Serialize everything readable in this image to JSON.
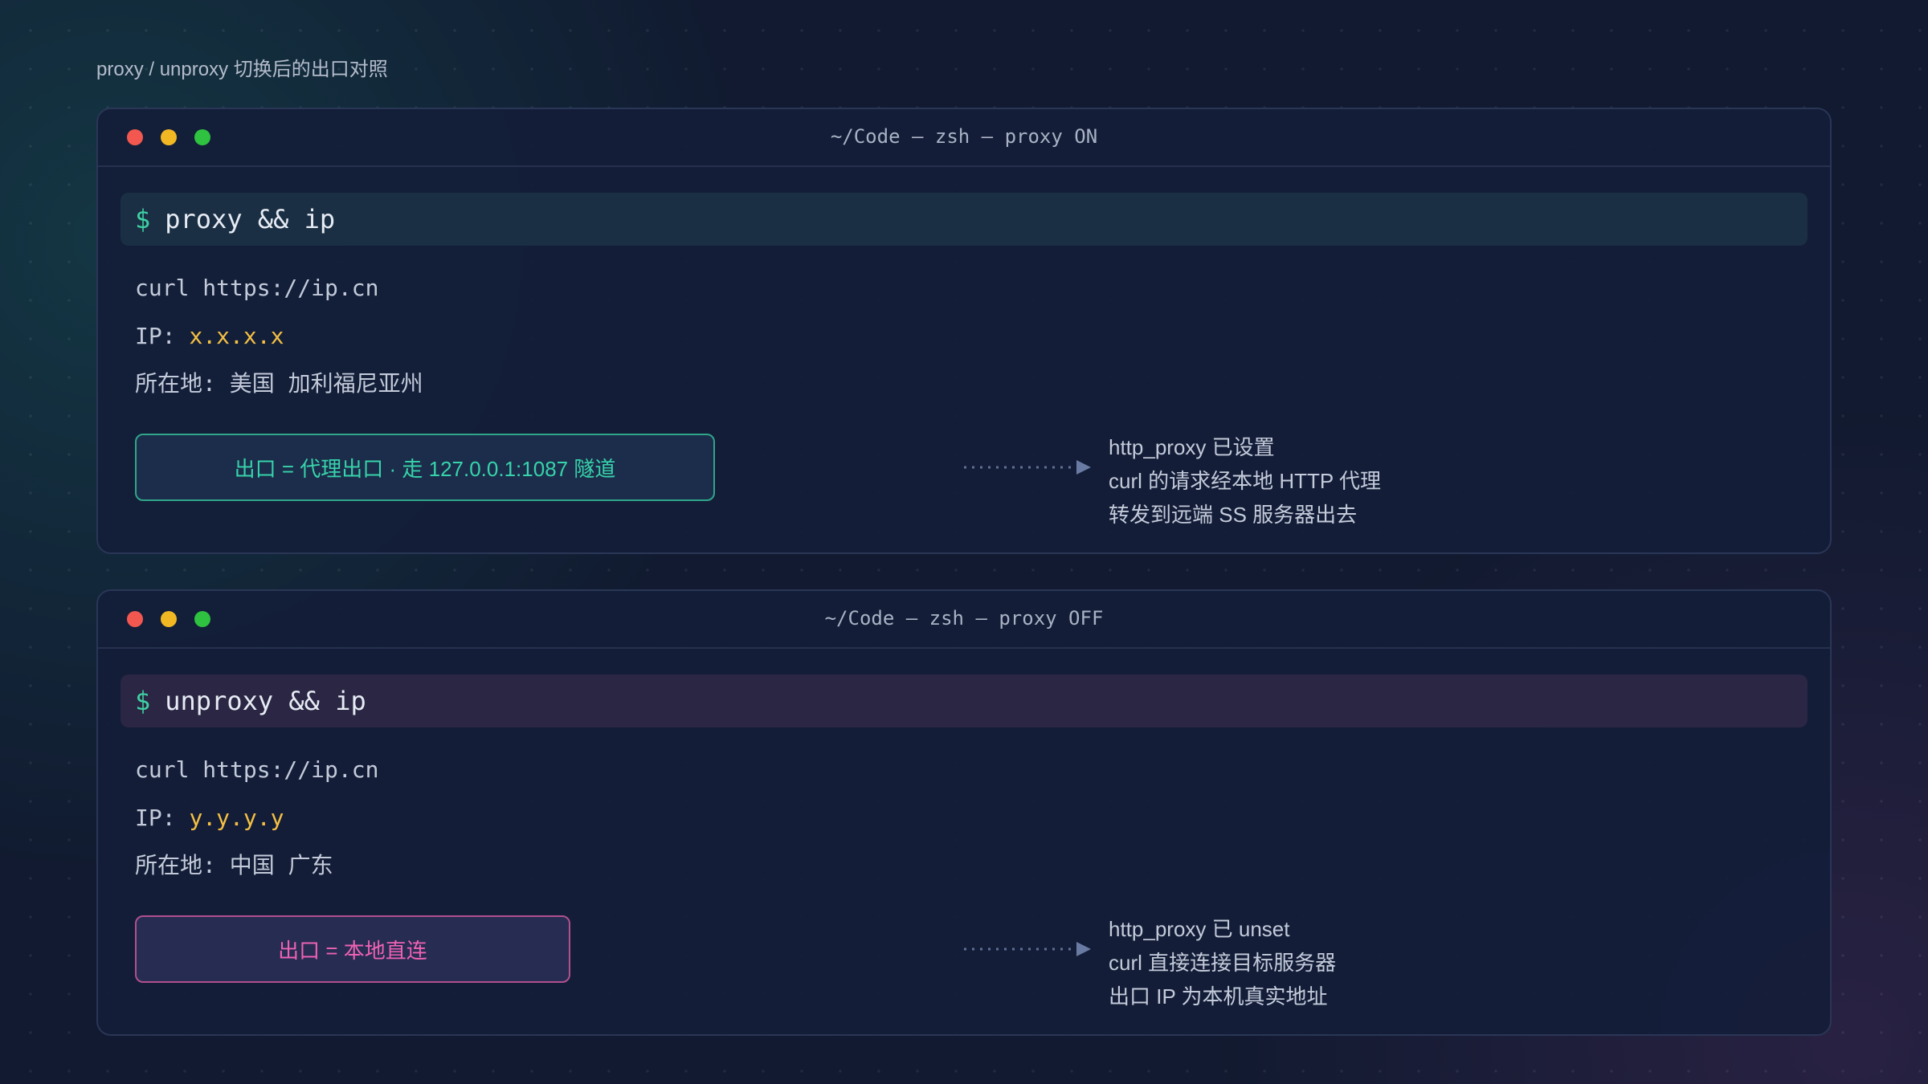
{
  "caption": "proxy / unproxy 切换后的出口对照",
  "windows": [
    {
      "title": "~/Code — zsh — proxy ON",
      "prompt": "$",
      "command": "proxy && ip",
      "curl_line": "curl https://ip.cn",
      "ip_label": "IP: ",
      "ip_value": "x.x.x.x",
      "location": "所在地: 美国 加利福尼亚州",
      "exit_label": "出口 = 代理出口 · 走 127.0.0.1:1087 隧道",
      "notes": [
        "http_proxy 已设置",
        "curl 的请求经本地 HTTP 代理",
        "转发到远端 SS 服务器出去"
      ]
    },
    {
      "title": "~/Code — zsh — proxy OFF",
      "prompt": "$",
      "command": "unproxy && ip",
      "curl_line": "curl https://ip.cn",
      "ip_label": "IP: ",
      "ip_value": "y.y.y.y",
      "location": "所在地: 中国 广东",
      "exit_label": "出口 = 本地直连",
      "notes": [
        "http_proxy 已 unset",
        "curl 直接连接目标服务器",
        "出口 IP 为本机真实地址"
      ]
    }
  ],
  "colors": {
    "background": "#111a30",
    "prompt": "#3fd0a3",
    "ip_value": "#f5c043",
    "proxy_on_accent": "#37d3ab",
    "proxy_off_accent": "#ee62b3",
    "traffic_red": "#f2584f",
    "traffic_yellow": "#f2b824",
    "traffic_green": "#2fc140"
  }
}
